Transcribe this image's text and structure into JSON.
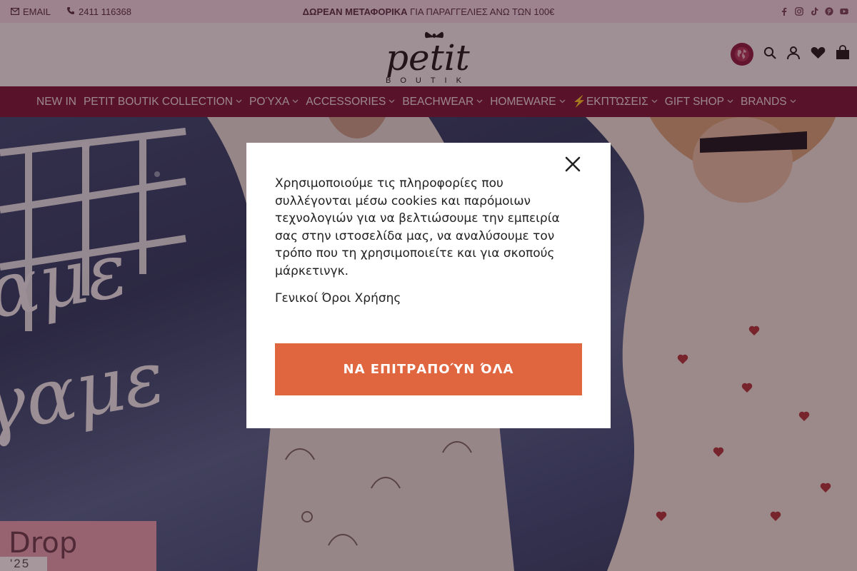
{
  "topbar": {
    "email_label": "EMAIL",
    "phone": "2411 116368",
    "promo_bold": "ΔΩΡΕΑΝ ΜΕΤΑΦΟΡΙΚΑ",
    "promo_rest": " ΓΙΑ ΠΑΡΑΓΓΕΛΙΕΣ ΑΝΩ ΤΩΝ 100€",
    "social": [
      "facebook-icon",
      "instagram-icon",
      "tiktok-icon",
      "pinterest-icon",
      "youtube-icon"
    ]
  },
  "header": {
    "logo_main": "petit",
    "logo_sub": "BOUTIK",
    "icons": [
      "globe-icon",
      "search-icon",
      "user-icon",
      "heart-icon",
      "bag-icon"
    ]
  },
  "nav": {
    "items": [
      {
        "label": "NEW IN",
        "has_dropdown": false
      },
      {
        "label": "PETIT BOUTIK COLLECTION",
        "has_dropdown": true
      },
      {
        "label": "ΡΟΎΧΑ",
        "has_dropdown": true
      },
      {
        "label": "ACCESSORIES",
        "has_dropdown": true
      },
      {
        "label": "BEACHWEAR",
        "has_dropdown": true
      },
      {
        "label": "HOMEWARE",
        "has_dropdown": true
      },
      {
        "label": "⚡ΕΚΠΤΏΣΕΙΣ",
        "has_dropdown": true
      },
      {
        "label": "GIFT SHOP",
        "has_dropdown": true
      },
      {
        "label": "BRANDS",
        "has_dropdown": true
      }
    ]
  },
  "hero": {
    "script_line1": "αμε",
    "script_line2": "γαμε",
    "drop_label": "Drop",
    "drop_year": "'25"
  },
  "cookie_modal": {
    "message": "Χρησιμοποιούμε τις πληροφορίες που συλλέγονται μέσω cookies και παρόμοιων τεχνολογιών για να βελτιώσουμε την εμπειρία σας στην ιστοσελίδα μας, να αναλύσουμε τον τρόπο που τη χρησιμοποιείτε και για σκοπούς μάρκετινγκ.",
    "terms_link": "Γενικοί Όροι Χρήσης",
    "accept_label": "ΝΑ ΕΠΙΤΡΑΠΟΎΝ ΌΛΑ"
  },
  "colors": {
    "topbar_bg": "#f0dce6",
    "nav_bg": "#7a1a3c",
    "accent_button": "#e0663f",
    "globe_bg": "#8d1f45"
  }
}
